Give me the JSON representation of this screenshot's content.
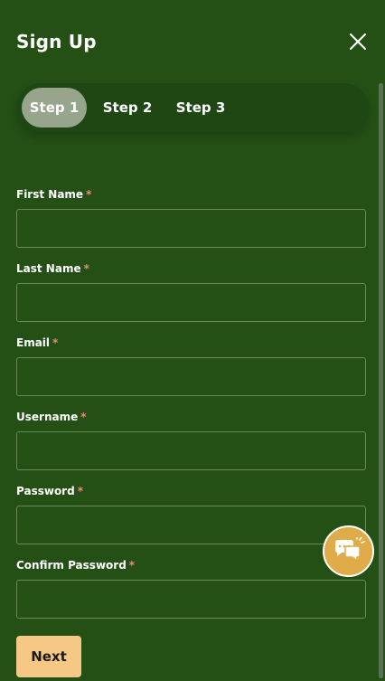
{
  "header": {
    "title": "Sign Up"
  },
  "steps": [
    {
      "label": "Step 1",
      "active": true
    },
    {
      "label": "Step 2",
      "active": false
    },
    {
      "label": "Step 3",
      "active": false
    }
  ],
  "form": {
    "required_marker": "*",
    "fields": [
      {
        "label": "First Name",
        "value": "",
        "placeholder": ""
      },
      {
        "label": "Last Name",
        "value": "",
        "placeholder": ""
      },
      {
        "label": "Email",
        "value": "",
        "placeholder": ""
      },
      {
        "label": "Username",
        "value": "",
        "placeholder": ""
      },
      {
        "label": "Password",
        "value": "",
        "placeholder": ""
      },
      {
        "label": "Confirm Password",
        "value": "",
        "placeholder": ""
      }
    ]
  },
  "actions": {
    "next_label": "Next"
  },
  "icons": {
    "close": "close-icon",
    "chat": "chat-bubbles-icon"
  },
  "colors": {
    "background": "#245016",
    "stepper_background": "#1f4714",
    "active_step": "#96a58b",
    "input_border": "#678a58",
    "required_marker": "#e88a7a",
    "next_button": "#f5c885",
    "chat_button": "#e0ac4a"
  }
}
